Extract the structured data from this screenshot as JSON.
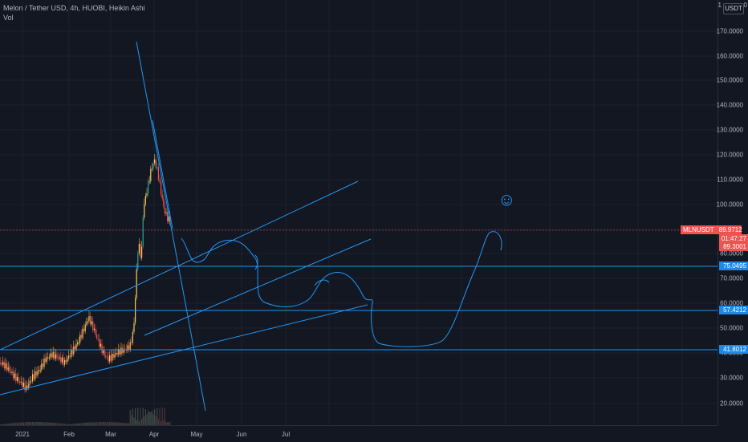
{
  "legend": {
    "title": "Melon / Tether USD, 4h, HUOBI, Heikin Ashi",
    "volume_label": "Vol"
  },
  "price_scale": {
    "currency": "USDT",
    "top_label": "1",
    "top_right_label": "0",
    "ticks": [
      "170.0000",
      "160.0000",
      "150.0000",
      "140.0000",
      "130.0000",
      "120.0000",
      "110.0000",
      "100.0000",
      "90.0000",
      "80.0000",
      "70.0000",
      "60.0000",
      "50.0000",
      "40.0000",
      "30.0000",
      "20.0000"
    ]
  },
  "time_axis": {
    "labels": [
      "2021",
      "Feb",
      "Mar",
      "Apr",
      "May",
      "Jun",
      "Jul"
    ]
  },
  "price_markers": {
    "symbol": "MLNUSDT",
    "last_price": "89.9712",
    "countdown": "01:47:27",
    "second_price": "89.3001",
    "horizontal_levels": [
      "75.0495",
      "57.4212",
      "41.8012"
    ]
  },
  "drawing_icon": "smiley-icon",
  "colors": {
    "background": "#131722",
    "up_candle": "#f2cc5a",
    "down_candle": "#ef5350",
    "teal_candle": "#26a69a",
    "drawing_line": "#2196f3",
    "price_line": "#ef5350"
  }
}
